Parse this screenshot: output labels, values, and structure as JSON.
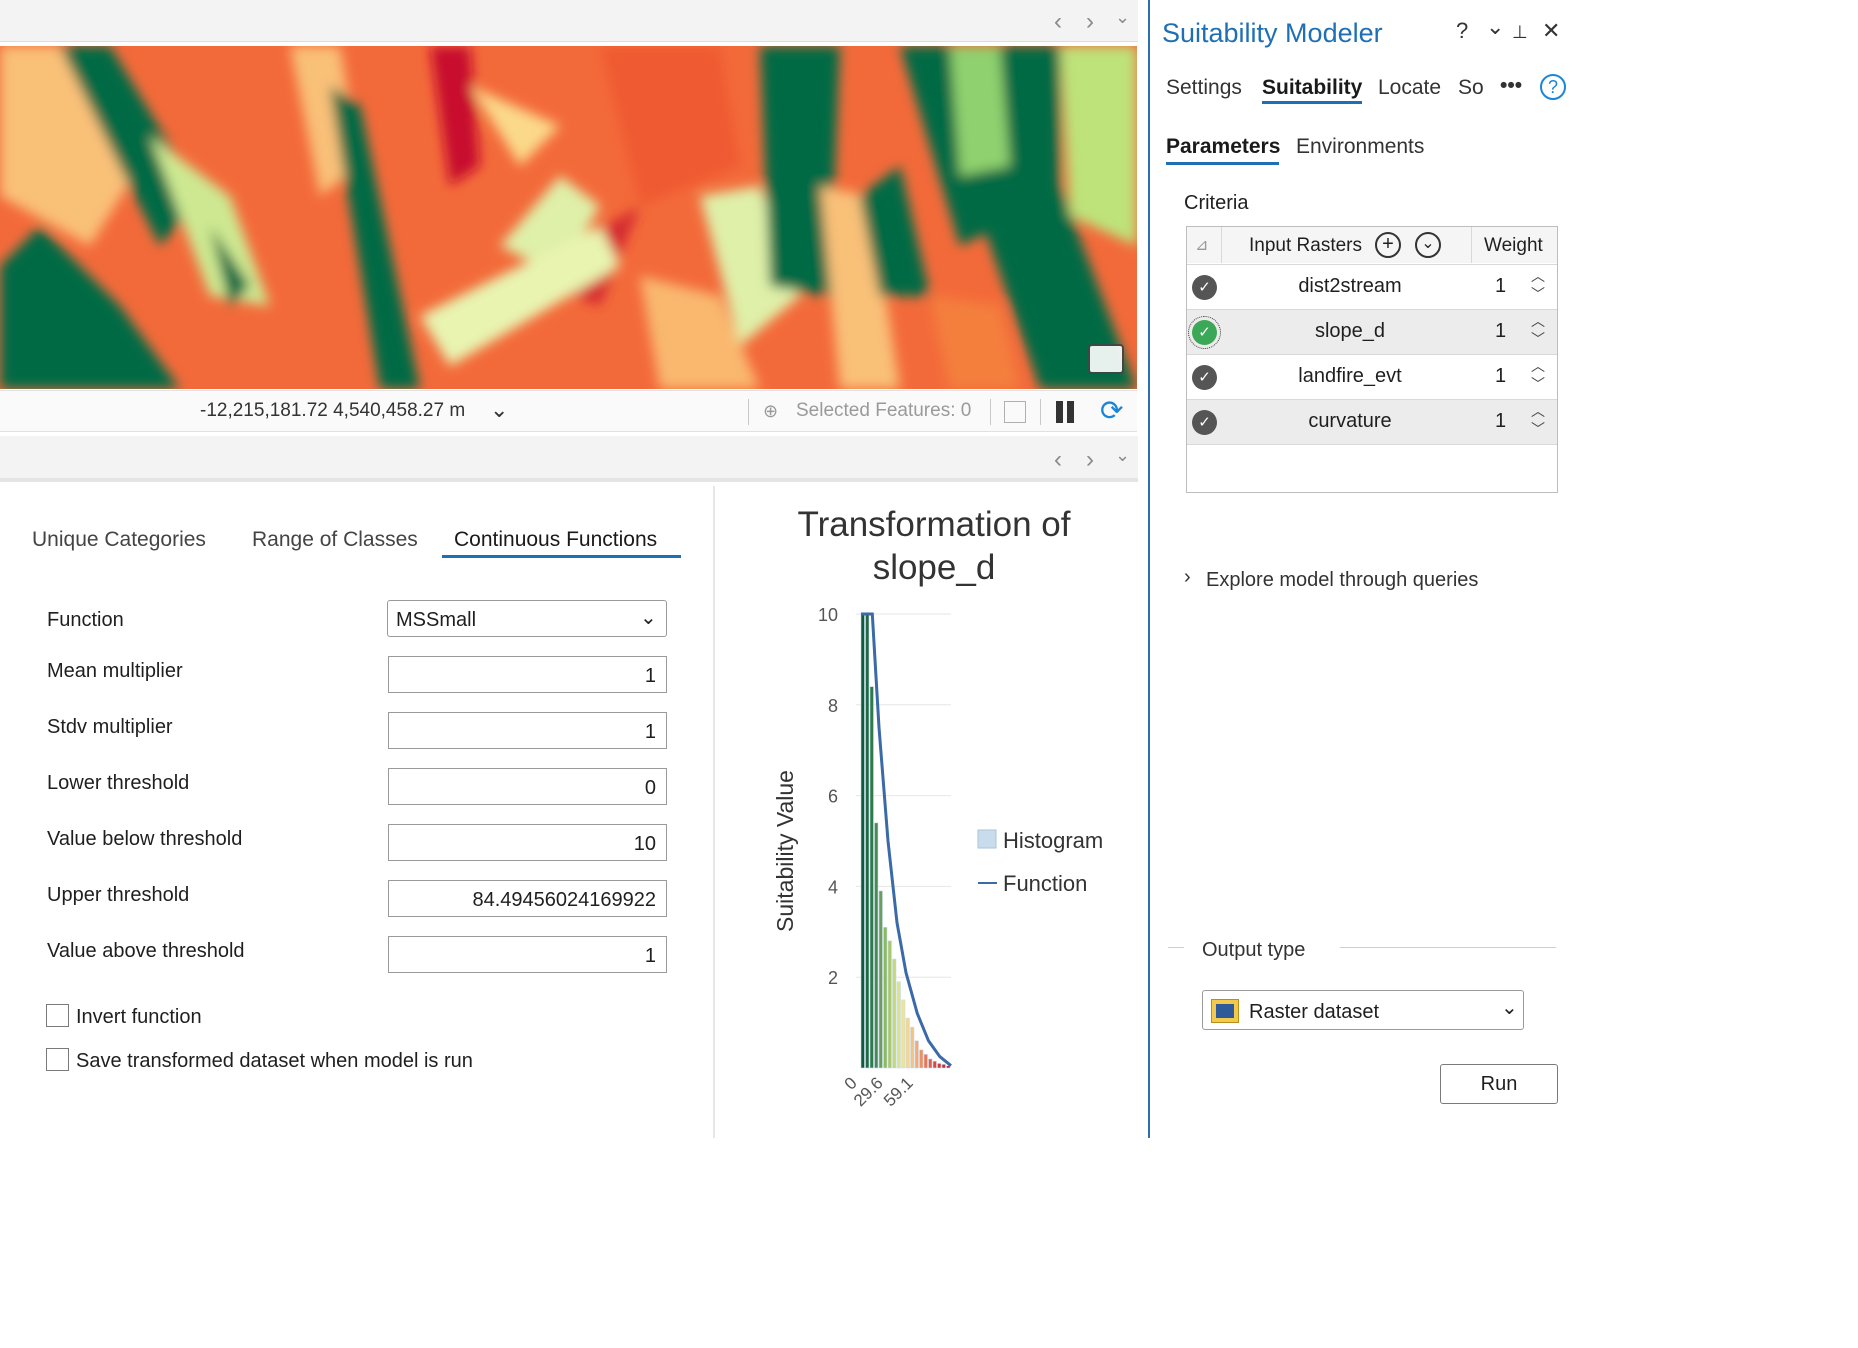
{
  "map": {
    "coordinates": "-12,215,181.72 4,540,458.27 m",
    "selected_features": "Selected Features: 0"
  },
  "transform_tabs": [
    {
      "label": "Unique Categories"
    },
    {
      "label": "Range of Classes"
    },
    {
      "label": "Continuous Functions"
    }
  ],
  "params": {
    "function_label": "Function",
    "function_value": "MSSmall",
    "fields": [
      {
        "label": "Mean multiplier",
        "value": "1"
      },
      {
        "label": "Stdv multiplier",
        "value": "1"
      },
      {
        "label": "Lower threshold",
        "value": "0"
      },
      {
        "label": "Value below threshold",
        "value": "10"
      },
      {
        "label": "Upper threshold",
        "value": "84.49456024169922"
      },
      {
        "label": "Value above threshold",
        "value": "1"
      }
    ],
    "checkboxes": [
      {
        "label": "Invert function",
        "checked": false
      },
      {
        "label": "Save transformed dataset when model is run",
        "checked": false
      }
    ]
  },
  "chart_data": {
    "type": "bar",
    "title": "Transformation of slope_d",
    "title_lines": [
      "Transformation of",
      "slope_d"
    ],
    "ylabel": "Suitability Value",
    "ylim": [
      0,
      10
    ],
    "yticks": [
      "2",
      "4",
      "6",
      "8",
      "10"
    ],
    "xticks": [
      "0",
      "29.6",
      "59.1"
    ],
    "legend": [
      {
        "name": "Histogram",
        "color": "#c9dcee"
      },
      {
        "name": "Function",
        "color": "#3a6aa8"
      }
    ],
    "legend_position": "right",
    "histogram_values": [
      10,
      10,
      8.4,
      5.4,
      3.9,
      3.1,
      2.8,
      2.4,
      1.9,
      1.5,
      1.1,
      0.9,
      0.6,
      0.4,
      0.3,
      0.2,
      0.15,
      0.1,
      0.08,
      0.05
    ],
    "function_points": [
      [
        0,
        10
      ],
      [
        3,
        10
      ],
      [
        5,
        10
      ],
      [
        8,
        7.5
      ],
      [
        12,
        5.0
      ],
      [
        16,
        3.2
      ],
      [
        20,
        2.1
      ],
      [
        25,
        1.2
      ],
      [
        30,
        0.6
      ],
      [
        35,
        0.25
      ],
      [
        40,
        0.05
      ]
    ],
    "xlim": [
      0,
      40
    ]
  },
  "dock": {
    "title": "Suitability Modeler",
    "tools": {
      "help": "?",
      "menu": "⌄",
      "pin": "📌",
      "close": "✕"
    },
    "tabs": [
      {
        "label": "Settings"
      },
      {
        "label": "Suitability"
      },
      {
        "label": "Locate"
      },
      {
        "label": "So"
      }
    ],
    "more": "•••",
    "subtabs": [
      {
        "label": "Parameters"
      },
      {
        "label": "Environments"
      }
    ],
    "criteria_label": "Criteria",
    "grid_header": {
      "name": "Input Rasters",
      "weight": "Weight"
    },
    "rasters": [
      {
        "name": "dist2stream",
        "weight": "1"
      },
      {
        "name": "slope_d",
        "weight": "1"
      },
      {
        "name": "landfire_evt",
        "weight": "1"
      },
      {
        "name": "curvature",
        "weight": "1"
      }
    ],
    "explore_label": "Explore model through queries",
    "output_type_label": "Output type",
    "output_type_value": "Raster dataset",
    "run_label": "Run"
  }
}
